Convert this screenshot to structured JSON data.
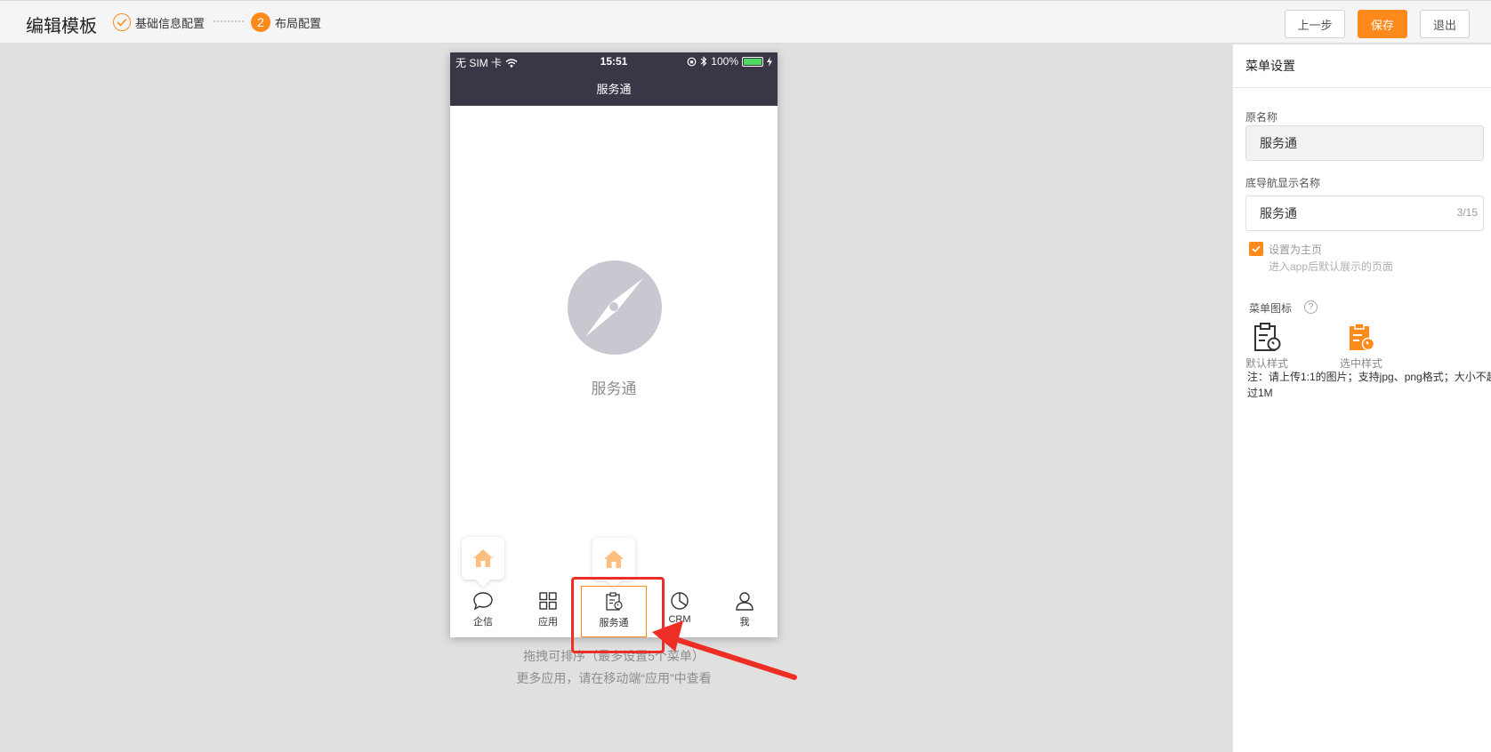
{
  "header": {
    "title": "编辑模板",
    "steps": [
      {
        "label": "基础信息配置",
        "status": "done"
      },
      {
        "number": "2",
        "label": "布局配置",
        "status": "active"
      }
    ],
    "buttons": {
      "prev": "上一步",
      "save": "保存",
      "exit": "退出"
    }
  },
  "phone": {
    "status_bar": {
      "carrier": "无 SIM 卡",
      "time": "15:51",
      "battery": "100%"
    },
    "nav_title": "服务通",
    "center_label": "服务通",
    "tabs": [
      {
        "label": "企信",
        "icon": "chat-bubble-icon"
      },
      {
        "label": "应用",
        "icon": "grid-icon"
      },
      {
        "label": "服务通",
        "icon": "clipboard-wrench-icon",
        "selected": true
      },
      {
        "label": "CRM",
        "icon": "pie-chart-icon"
      },
      {
        "label": "我",
        "icon": "user-icon"
      }
    ]
  },
  "hints": {
    "line1": "拖拽可排序（最多设置5个菜单）",
    "line2": "更多应用，请在移动端“应用”中查看"
  },
  "panel": {
    "title": "菜单设置",
    "original_name_label": "原名称",
    "original_name_value": "服务通",
    "display_name_label": "底导航显示名称",
    "display_name_value": "服务通",
    "display_name_counter": "3/15",
    "set_home_label": "设置为主页",
    "set_home_sub": "进入app后默认展示的页面",
    "set_home_checked": true,
    "menu_icon_label": "菜单图标",
    "default_style_label": "默认样式",
    "selected_style_label": "选中样式",
    "note_line1": "注：请上传1:1的图片；支持jpg、png格式；大小不超",
    "note_line2": "过1M"
  },
  "colors": {
    "accent": "#ff8a1c",
    "dark_bar": "#3b3645",
    "annotation_red": "#ee2e24"
  }
}
